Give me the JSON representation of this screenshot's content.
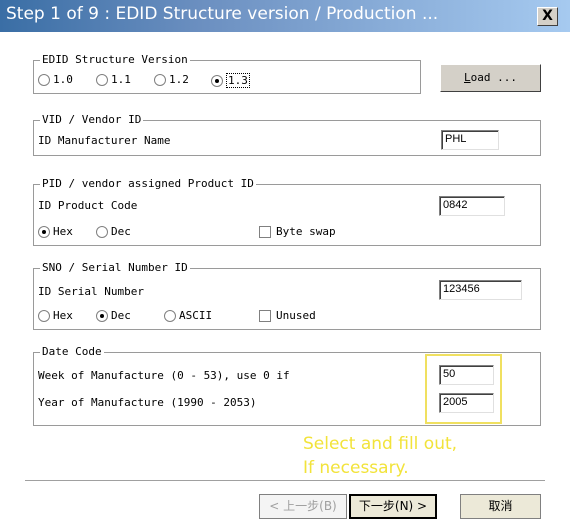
{
  "window": {
    "title": "Step 1 of 9 : EDID Structure version / Production ...",
    "close_label": "X"
  },
  "edid_version": {
    "title": "EDID Structure Version",
    "options": [
      "1.0",
      "1.1",
      "1.2",
      "1.3"
    ],
    "selected": "1.3",
    "load_button": {
      "accel": "L",
      "rest": "oad ..."
    }
  },
  "vid": {
    "title": "VID / Vendor ID",
    "field_label": "ID Manufacturer Name",
    "value": "PHL"
  },
  "pid": {
    "title": "PID / vendor assigned Product ID",
    "field_label": "ID Product Code",
    "value": "0842",
    "radio_hex": "Hex",
    "radio_dec": "Dec",
    "selected": "Hex",
    "checkbox_label": "Byte swap",
    "checked": false
  },
  "sno": {
    "title": "SNO / Serial Number ID",
    "field_label": "ID Serial Number",
    "value": "123456",
    "radio_hex": "Hex",
    "radio_dec": "Dec",
    "radio_ascii": "ASCII",
    "selected": "Dec",
    "checkbox_label": "Unused",
    "checked": false
  },
  "date_code": {
    "title": "Date Code",
    "week_label": "Week of Manufacture (0 - 53), use 0 if",
    "week_value": "50",
    "year_label": "Year of Manufacture (1990 - 2053)",
    "year_value": "2005"
  },
  "annotation": {
    "line1": "Select and fill out,",
    "line2": "If necessary.",
    "color": "#f2e33a"
  },
  "buttons": {
    "back": "< 上一步(B)",
    "next": "下一步(N) >",
    "cancel": "取消"
  }
}
